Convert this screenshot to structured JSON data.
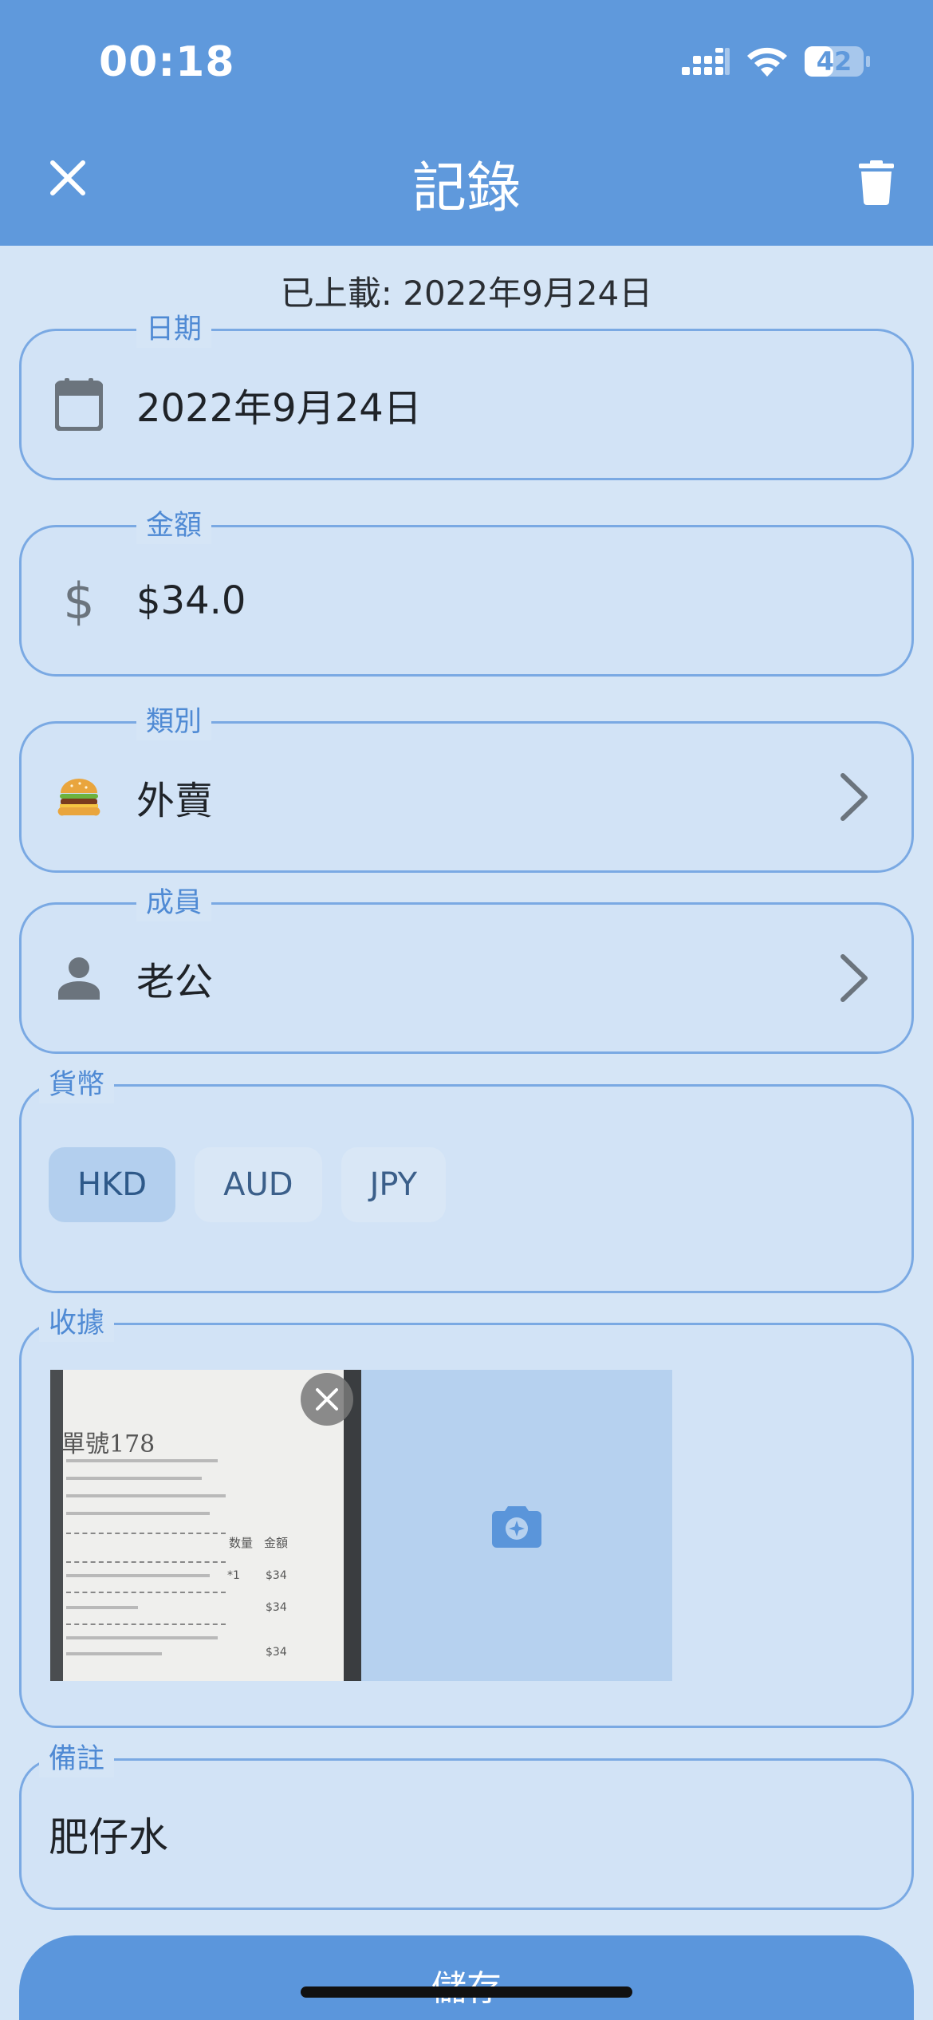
{
  "status_bar": {
    "time": "00:18",
    "battery": "42"
  },
  "header": {
    "title": "記錄",
    "close_icon": "close-icon",
    "delete_icon": "trash-icon"
  },
  "uploaded_text": "已上載: 2022年9月24日",
  "fields": {
    "date": {
      "label": "日期",
      "value": "2022年9月24日",
      "icon": "calendar-icon"
    },
    "amount": {
      "label": "金額",
      "value": "$34.0",
      "icon": "dollar-icon"
    },
    "category": {
      "label": "類別",
      "value": "外賣",
      "emoji": "🍔"
    },
    "member": {
      "label": "成員",
      "value": "老公",
      "icon": "person-icon"
    },
    "currency": {
      "label": "貨幣",
      "options": [
        "HKD",
        "AUD",
        "JPY"
      ],
      "selected": "HKD"
    },
    "receipt": {
      "label": "收據",
      "photo_text": {
        "header": "單號178",
        "col_qty": "数量",
        "col_amount": "金額",
        "line1_qty": "*1",
        "line1_amount": "$34",
        "line2_amount": "$34",
        "total_amount": "$34"
      }
    },
    "note": {
      "label": "備註",
      "value": "肥仔水"
    }
  },
  "save_label": "儲存",
  "colors": {
    "header": "#5f99dc",
    "background": "#d5e5f6",
    "border": "#7aa9e3",
    "accent": "#4f8ad4"
  }
}
